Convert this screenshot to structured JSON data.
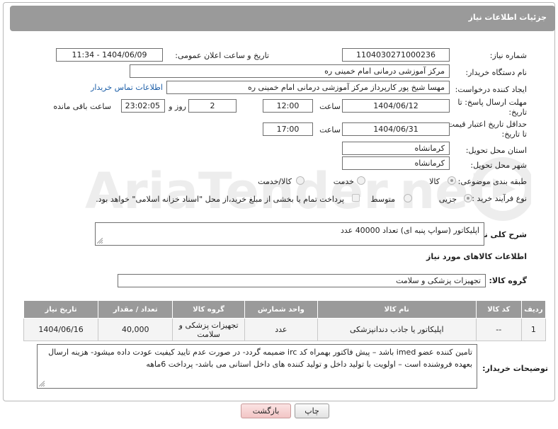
{
  "header": {
    "title": "جزئیات اطلاعات نیاز"
  },
  "fields": {
    "need_number_label": "شماره نیاز:",
    "need_number": "1104030271000236",
    "announce_label": "تاریخ و ساعت اعلان عمومی:",
    "announce_value": "1404/06/09 - 11:34",
    "buyer_org_label": "نام دستگاه خریدار:",
    "buyer_org": "مرکز آموزشی درمانی امام خمینی ره",
    "creator_label": "ایجاد کننده درخواست:",
    "creator": "مهسا شیخ پور کارپرداز مرکز آموزشی درمانی امام خمینی ره",
    "contact_link": "اطلاعات تماس خریدار",
    "deadline_label_1": "مهلت ارسال پاسخ: تا",
    "deadline_label_2": "تاریخ:",
    "deadline_date": "1404/06/12",
    "time_label": "ساعت",
    "deadline_time": "12:00",
    "days_value": "2",
    "days_label": "روز و",
    "remaining_time": "23:02:05",
    "remaining_label": "ساعت باقی مانده",
    "validity_label_1": "حداقل تاریخ اعتبار قیمت:",
    "validity_label_2": "تا تاریخ:",
    "validity_date": "1404/06/31",
    "validity_time_label": "ساعت",
    "validity_time": "17:00",
    "province_label": "استان محل تحویل:",
    "province": "کرمانشاه",
    "city_label": "شهر محل تحویل:",
    "city": "کرمانشاه",
    "category_label": "طبقه بندی موضوعی:",
    "category_options": [
      "کالا",
      "خدمت",
      "کالا/خدمت"
    ],
    "category_selected": "کالا",
    "process_label": "نوع فرآیند خرید :",
    "process_options": [
      "جزیی",
      "متوسط"
    ],
    "process_selected": "جزیی",
    "payment_note": "پرداخت تمام یا بخشی از مبلغ خرید،از محل \"اسناد خزانه اسلامی\" خواهد بود."
  },
  "description": {
    "label": "شرح کلی نیاز:",
    "value": "اپلیکاتور (سواپ پنبه ای) تعداد 40000 عدد"
  },
  "goods_section": {
    "title": "اطلاعات کالاهای مورد نیاز",
    "group_label": "گروه کالا:",
    "group_value": "تجهیزات پزشکی و سلامت"
  },
  "table": {
    "headers": [
      "ردیف",
      "کد کالا",
      "نام کالا",
      "واحد شمارش",
      "گروه کالا",
      "تعداد / مقدار",
      "تاریخ نیاز"
    ],
    "rows": [
      [
        "1",
        "--",
        "اپلیکاتور یا جاذب دندانپزشکی",
        "عدد",
        "تجهیزات پزشکی و سلامت",
        "40,000",
        "1404/06/16"
      ]
    ]
  },
  "buyer_notes": {
    "label": "توضیحات خریدار:",
    "value": "تامین کننده عضو imed باشد – پیش فاکتور بهمراه کد irc ضمیمه گردد- در صورت عدم تایید کیفیت عودت داده میشود- هزینه ارسال بعهده فروشنده است – اولویت با تولید داخل و تولید کننده های داخل استانی می باشد- پرداخت 6ماهه"
  },
  "buttons": {
    "print": "چاپ",
    "back": "بازگشت"
  },
  "watermark": {
    "text": "AriaTender.net"
  },
  "colors": {
    "header_bg": "#9a9a9a",
    "link": "#1d5fa8",
    "back_button": "#f2c5c5"
  }
}
